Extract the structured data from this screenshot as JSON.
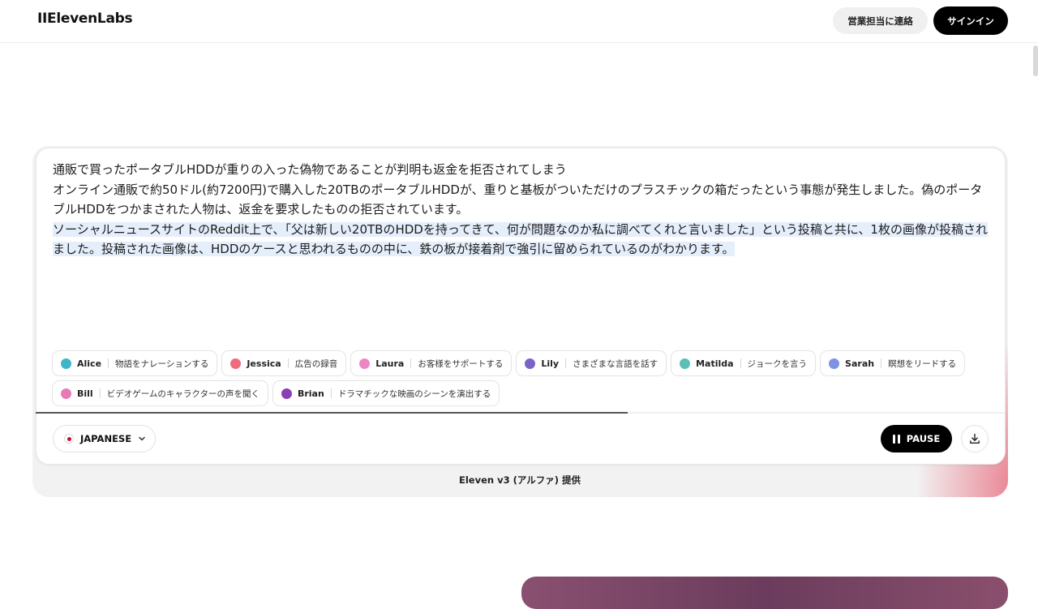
{
  "header": {
    "logo": "IIElevenLabs",
    "contact_sales": "営業担当に連絡",
    "sign_in": "サインイン"
  },
  "editor": {
    "lines": [
      "通販で買ったポータブルHDDが重りの入った偽物であることが判明も返金を拒否されてしまう",
      "オンライン通販で約50ドル(約7200円)で購入した20TBのポータブルHDDが、重りと基板がついただけのプラスチックの箱だったという事態が発生しました。偽のポータブルHDDをつかまされた人物は、返金を要求したものの拒否されています。",
      "ソーシャルニュースサイトのReddit上で、「父は新しい20TBのHDDを持ってきて、何が問題なのか私に調べてくれと言いました」という投稿と共に、1枚の画像が投稿されました。投稿された画像は、HDDのケースと思われるものの中に、鉄の板が接着剤で強引に留められているのがわかります。"
    ]
  },
  "voices": [
    {
      "name": "Alice",
      "desc": "物語をナレーションする",
      "color": "#3fb5c9"
    },
    {
      "name": "Jessica",
      "desc": "広告の録音",
      "color": "#f06a7e"
    },
    {
      "name": "Laura",
      "desc": "お客様をサポートする",
      "color": "#ee86c4"
    },
    {
      "name": "Lily",
      "desc": "さまざまな言語を話す",
      "color": "#7a64c9"
    },
    {
      "name": "Matilda",
      "desc": "ジョークを言う",
      "color": "#5bbfb5"
    },
    {
      "name": "Sarah",
      "desc": "瞑想をリードする",
      "color": "#7d92e2"
    },
    {
      "name": "Bill",
      "desc": "ビデオゲームのキャラクターの声を聞く",
      "color": "#e979b6"
    },
    {
      "name": "Brian",
      "desc": "ドラマチックな映画のシーンを演出する",
      "color": "#8a3fb4"
    }
  ],
  "playback": {
    "progress": 0.61
  },
  "controls": {
    "language": "JAPANESE",
    "pause": "PAUSE"
  },
  "footer": {
    "powered_by": "Eleven v3 (アルファ) 提供"
  }
}
